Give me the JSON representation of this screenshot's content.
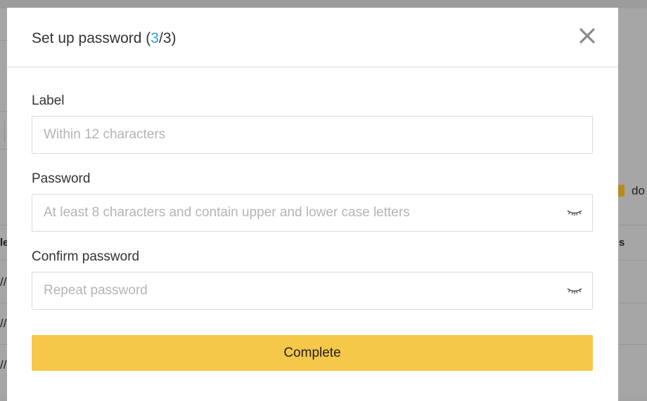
{
  "background": {
    "doc_label": "do",
    "column_fragment": "s",
    "row_fragments": [
      "le",
      "//",
      "//",
      "//"
    ]
  },
  "dialog": {
    "title": "Set up password",
    "step_open": "(",
    "step_current": "3",
    "step_separator": "/",
    "step_total": "3",
    "step_close": ")",
    "close_icon": "close-icon",
    "fields": {
      "label": {
        "label": "Label",
        "placeholder": "Within 12 characters",
        "value": ""
      },
      "password": {
        "label": "Password",
        "placeholder": "At least 8 characters and contain upper and lower case letters",
        "value": "",
        "icon": "eye-closed-icon"
      },
      "confirm": {
        "label": "Confirm password",
        "placeholder": "Repeat password",
        "value": "",
        "icon": "eye-closed-icon"
      }
    },
    "submit_label": "Complete"
  },
  "colors": {
    "accent": "#2b9fd6",
    "primary_button": "#f5c84a",
    "overlay": "#a6a6a6"
  }
}
